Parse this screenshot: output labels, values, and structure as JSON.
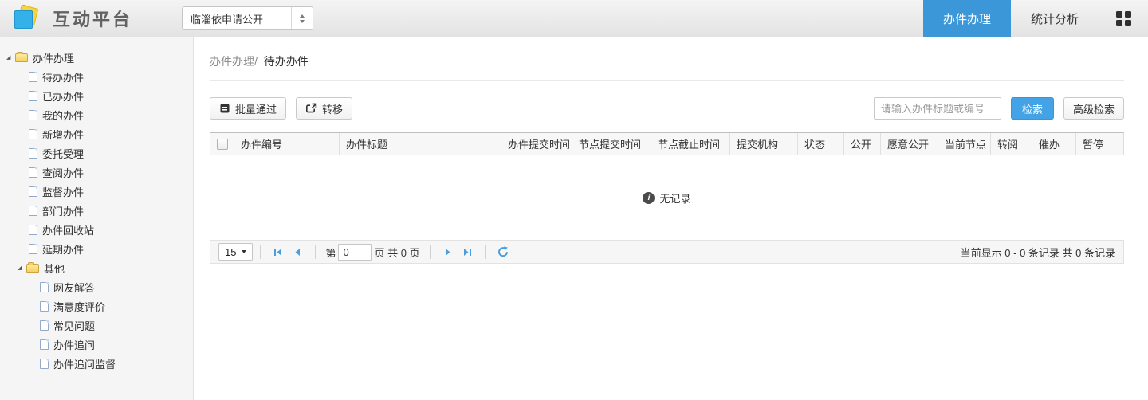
{
  "app": {
    "title": "互动平台"
  },
  "header": {
    "site_selector": {
      "value": "临淄依申请公开"
    },
    "tabs": [
      {
        "label": "办件办理",
        "active": true
      },
      {
        "label": "统计分析",
        "active": false
      }
    ]
  },
  "sidebar": {
    "tree": [
      {
        "label": "办件办理",
        "children": [
          "待办办件",
          "已办办件",
          "我的办件",
          "新增办件",
          "委托受理",
          "查阅办件",
          "监督办件",
          "部门办件",
          "办件回收站",
          "延期办件"
        ]
      },
      {
        "label": "其他",
        "children": [
          "网友解答",
          "满意度评价",
          "常见问题",
          "办件追问",
          "办件追问监督"
        ]
      }
    ]
  },
  "main": {
    "breadcrumb": {
      "section": "办件办理/",
      "page": "待办办件"
    },
    "toolbar": {
      "batch_button": "批量通过",
      "transfer_button": "转移"
    },
    "search": {
      "placeholder": "请输入办件标题或编号",
      "submit": "检索",
      "advanced": "高级检索"
    },
    "table": {
      "columns": [
        "办件编号",
        "办件标题",
        "办件提交时间",
        "节点提交时间",
        "节点截止时间",
        "提交机构",
        "状态",
        "公开",
        "愿意公开",
        "当前节点",
        "转阅",
        "催办",
        "暂停"
      ],
      "empty_message": "无记录",
      "rows": []
    },
    "pager": {
      "page_size": "15",
      "page_prefix": "第",
      "page_value": "0",
      "page_suffix": "页 共 0 页",
      "summary": "当前显示 0 - 0 条记录 共 0 条记录"
    }
  },
  "icons": {
    "expander": "◢",
    "info_glyph": "i"
  },
  "colors": {
    "tab_active": "#3b97d8",
    "search_button": "#43a3e6",
    "pager_icon": "#4a9ede"
  }
}
